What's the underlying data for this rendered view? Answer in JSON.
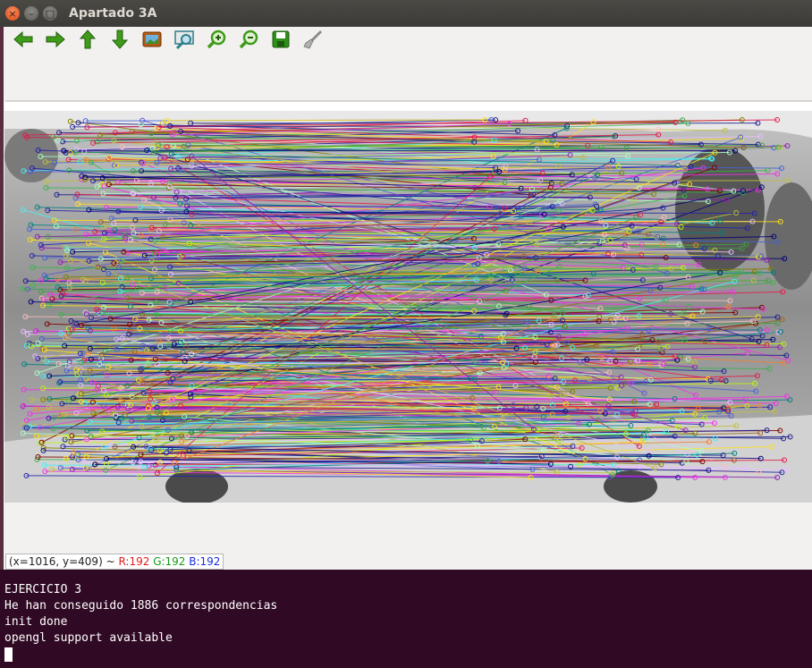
{
  "window": {
    "title": "Apartado 3A",
    "controls": {
      "close": "×",
      "minimize": "–",
      "maximize": "□"
    }
  },
  "toolbar": {
    "items": [
      {
        "name": "arrow-left-icon",
        "color": "#3f9b1a"
      },
      {
        "name": "arrow-right-icon",
        "color": "#3f9b1a"
      },
      {
        "name": "arrow-up-icon",
        "color": "#3f9b1a"
      },
      {
        "name": "arrow-down-icon",
        "color": "#3f9b1a"
      },
      {
        "name": "image-icon",
        "color": "#b35a14"
      },
      {
        "name": "zoom-fit-icon",
        "color": "#2e7d8c"
      },
      {
        "name": "zoom-in-icon",
        "color": "#3f9b1a"
      },
      {
        "name": "zoom-out-icon",
        "color": "#3f9b1a"
      },
      {
        "name": "save-icon",
        "color": "#2f8f1a"
      },
      {
        "name": "brush-icon",
        "color": "#8a8a8a"
      }
    ]
  },
  "image": {
    "description_icon": "feature-matches-image"
  },
  "status": {
    "coords": "(x=1016, y=409) ~ ",
    "r": "R:192",
    "g": "G:192",
    "b": "B:192"
  },
  "terminal": {
    "lines": [
      "EJERCICIO 3",
      "He han conseguido 1886 correspondencias",
      "init done",
      "opengl support available"
    ],
    "background": "#300a24"
  }
}
